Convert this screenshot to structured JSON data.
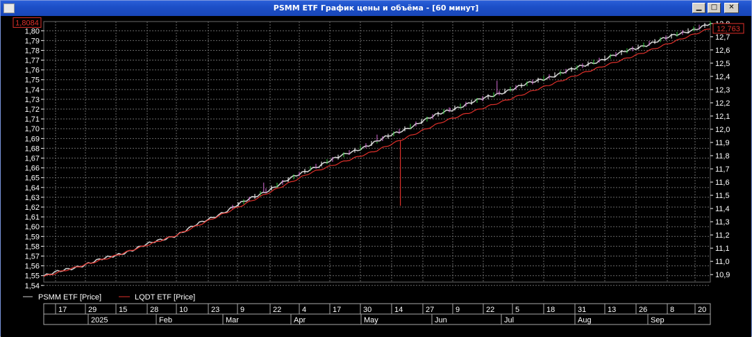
{
  "window": {
    "title": "PSMM ETF График цены и объёма - [60 минут]",
    "buttons": {
      "minimize": "▁",
      "maximize": "□",
      "close": "✕"
    }
  },
  "colors": {
    "background": "#000000",
    "grid": "#6a6a6a",
    "psmm": "#cfcfcf",
    "lqdt": "#e0302a",
    "accent_green": "#2fcf3a",
    "accent_magenta": "#d86cd8",
    "axis_text": "#ffffff",
    "last_value_box": "#e0302a"
  },
  "chart_data": {
    "type": "line",
    "title": "",
    "left_axis": {
      "ticks": [
        "1,80",
        "1,79",
        "1,78",
        "1,77",
        "1,76",
        "1,75",
        "1,74",
        "1,73",
        "1,72",
        "1,71",
        "1,70",
        "1,69",
        "1,68",
        "1,67",
        "1,66",
        "1,65",
        "1,64",
        "1,63",
        "1,62",
        "1,61",
        "1,60",
        "1,59",
        "1,58",
        "1,57",
        "1,56",
        "1,55",
        "1,54"
      ],
      "ylim": [
        1.5434,
        1.8094
      ],
      "last_value": "1,8084"
    },
    "right_axis": {
      "ticks": [
        "12,8",
        "12,7",
        "12,6",
        "12,5",
        "12,4",
        "12,3",
        "12,2",
        "12,1",
        "12,0",
        "11,9",
        "11,8",
        "11,7",
        "11,6",
        "11,5",
        "11,4",
        "11,3",
        "11,2",
        "11,1",
        "11,0",
        "10,9"
      ],
      "ylim": [
        10.843,
        12.815
      ],
      "last_value": "12,763"
    },
    "x_axis": {
      "day_ticks": [
        "17",
        "29",
        "15",
        "28",
        "10",
        "23",
        "9",
        "22",
        "4",
        "17",
        "30",
        "14",
        "27",
        "9",
        "22",
        "5",
        "18",
        "31",
        "13",
        "26",
        "8",
        "20"
      ],
      "month_labels": [
        "2025",
        "Feb",
        "Mar",
        "Apr",
        "May",
        "Jun",
        "Jul",
        "Aug",
        "Sep"
      ]
    },
    "legend": [
      "PSMM ETF [Price]",
      "LQDT ETF [Price]"
    ],
    "series": [
      {
        "name": "PSMM ETF [Price]",
        "axis": "left",
        "x": [
          0.0,
          0.1,
          0.2,
          0.3,
          0.4,
          0.5,
          0.6,
          0.7,
          0.8,
          0.9,
          1.0
        ],
        "values": [
          1.5495,
          1.569,
          1.592,
          1.625,
          1.659,
          1.687,
          1.717,
          1.74,
          1.762,
          1.785,
          1.807
        ],
        "spikes_up": [
          [
            0.33,
            1.645
          ],
          [
            0.5,
            1.694
          ],
          [
            0.61,
            1.721
          ],
          [
            0.68,
            1.749
          ]
        ]
      },
      {
        "name": "LQDT ETF [Price]",
        "axis": "right",
        "x": [
          0.0,
          0.1,
          0.2,
          0.3,
          0.4,
          0.5,
          0.6,
          0.7,
          0.8,
          0.9,
          1.0
        ],
        "values": [
          10.885,
          11.03,
          11.2,
          11.43,
          11.67,
          11.84,
          12.06,
          12.23,
          12.41,
          12.58,
          12.763
        ],
        "spike_down": [
          0.535,
          11.42
        ]
      }
    ]
  }
}
